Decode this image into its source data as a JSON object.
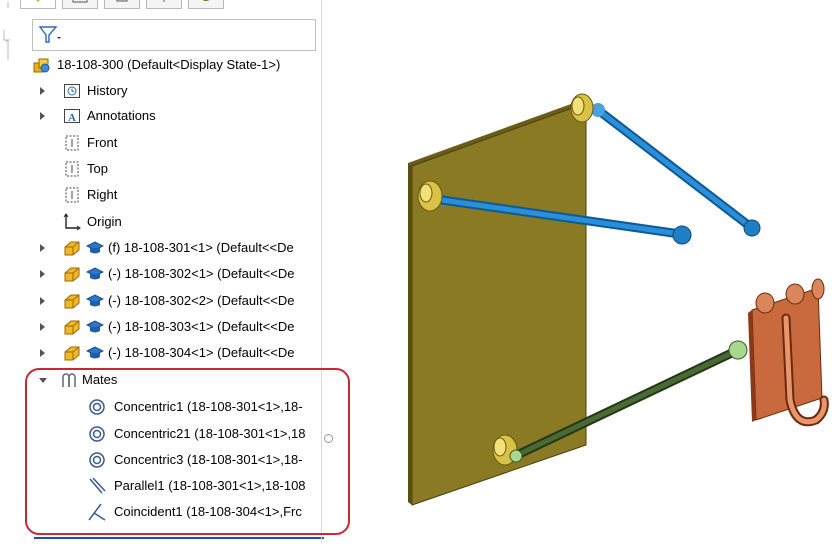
{
  "feature_tree": {
    "root": {
      "label": "18-108-300  (Default<Display State-1>)",
      "icon": "assembly-icon"
    },
    "items": [
      {
        "label": "History",
        "icon": "history-icon",
        "expander": "collapsed"
      },
      {
        "label": "Annotations",
        "icon": "annotations-icon",
        "expander": "collapsed"
      },
      {
        "label": "Front",
        "icon": "plane-icon",
        "expander": "none"
      },
      {
        "label": "Top",
        "icon": "plane-icon",
        "expander": "none"
      },
      {
        "label": "Right",
        "icon": "plane-icon",
        "expander": "none"
      },
      {
        "label": "Origin",
        "icon": "origin-icon",
        "expander": "none"
      }
    ],
    "components": [
      {
        "label": "(f) 18-108-301<1> (Default<<De"
      },
      {
        "label": "(-) 18-108-302<1> (Default<<De"
      },
      {
        "label": "(-) 18-108-302<2> (Default<<De"
      },
      {
        "label": "(-) 18-108-303<1> (Default<<De"
      },
      {
        "label": "(-) 18-108-304<1> (Default<<De"
      }
    ],
    "mates": {
      "label": "Mates",
      "items": [
        {
          "label": "Concentric1 (18-108-301<1>,18-",
          "icon": "concentric-mate-icon"
        },
        {
          "label": "Concentric21 (18-108-301<1>,18",
          "icon": "concentric-mate-icon"
        },
        {
          "label": "Concentric3 (18-108-301<1>,18-",
          "icon": "concentric-mate-icon"
        },
        {
          "label": "Parallel1 (18-108-301<1>,18-108",
          "icon": "parallel-mate-icon"
        },
        {
          "label": "Coincident1 (18-108-304<1>,Frc",
          "icon": "coincident-mate-icon"
        }
      ]
    }
  },
  "colors": {
    "highlight": "#c8263a",
    "plate": "#8a7a24",
    "blue_rod": "#1e7fc4",
    "green_rod": "#3e5a2a",
    "hook": "#d97a4a",
    "bushing": "#d9c247"
  }
}
